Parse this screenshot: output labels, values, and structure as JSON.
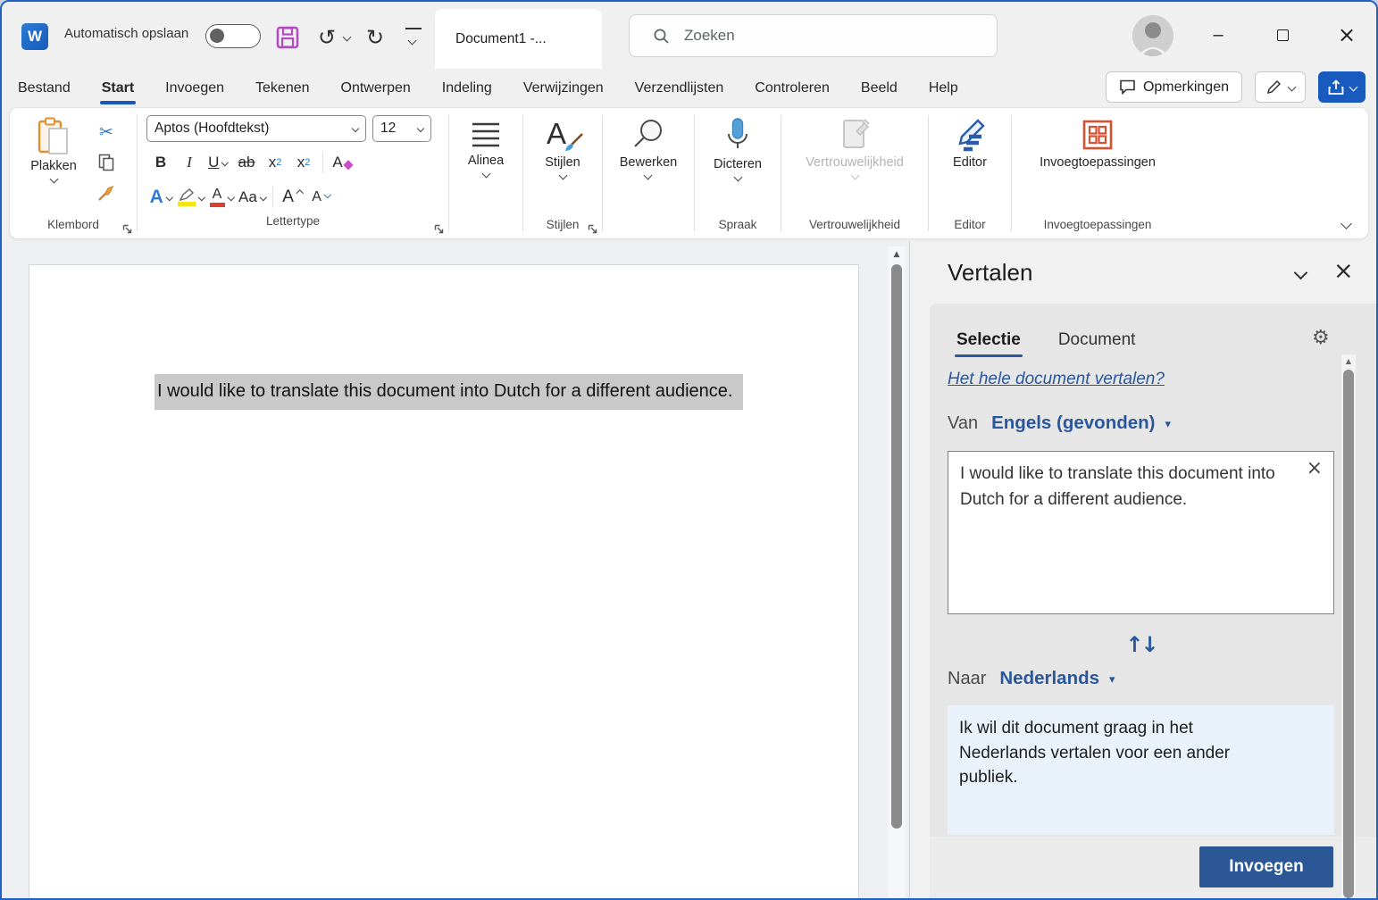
{
  "window": {
    "autosave_label": "Automatisch opslaan",
    "doc_tab": "Document1  -...",
    "search_placeholder": "Zoeken"
  },
  "icons": {
    "undo": "↺",
    "redo": "↻",
    "minimize": "–",
    "close_window": "×",
    "scissors": "✂",
    "gear": "⚙",
    "scroll_up": "▲",
    "dropdown": "▾",
    "swap": "↑↓",
    "clear_x": "×",
    "panel_close": "×"
  },
  "menu": {
    "tabs": [
      {
        "label": "Bestand"
      },
      {
        "label": "Start"
      },
      {
        "label": "Invoegen"
      },
      {
        "label": "Tekenen"
      },
      {
        "label": "Ontwerpen"
      },
      {
        "label": "Indeling"
      },
      {
        "label": "Verwijzingen"
      },
      {
        "label": "Verzendlijsten"
      },
      {
        "label": "Controleren"
      },
      {
        "label": "Beeld"
      },
      {
        "label": "Help"
      }
    ],
    "comments_label": "Opmerkingen"
  },
  "ribbon": {
    "paste_label": "Plakken",
    "clipboard_group": "Klembord",
    "font_name": "Aptos (Hoofdtekst)",
    "font_size": "12",
    "font_group": "Lettertype",
    "bold": "B",
    "italic": "I",
    "underline": "U",
    "strikethrough": "ab",
    "sub_base": "x",
    "sub_small": "2",
    "sup_base": "x",
    "sup_small": "2",
    "clear_format": "A",
    "text_effects": "A",
    "font_color": "A",
    "change_case": "Aa",
    "grow_font": "A",
    "shrink_font": "A",
    "paragraph_label": "Alinea",
    "styles_label": "Stijlen",
    "styles_group": "Stijlen",
    "editing_label": "Bewerken",
    "dictate_label": "Dicteren",
    "speech_group": "Spraak",
    "sensitivity_label": "Vertrouwelijkheid",
    "sensitivity_group": "Vertrouwelijkheid",
    "editor_label": "Editor",
    "editor_group": "Editor",
    "addins_label": "Invoegtoepassingen",
    "addins_group": "Invoegtoepassingen"
  },
  "document": {
    "selected_text": "I would like to translate this document into Dutch for a different audience."
  },
  "panel": {
    "title": "Vertalen",
    "tab_selection": "Selectie",
    "tab_document": "Document",
    "translate_all_link": "Het hele document vertalen?",
    "from_label": "Van",
    "from_language": "Engels (gevonden)",
    "source_text": "I would like to translate this document into Dutch for a different audience.",
    "to_label": "Naar",
    "to_language": "Nederlands",
    "result_text": "Ik wil dit document graag in het Nederlands vertalen voor een ander publiek.",
    "insert_button": "Invoegen"
  },
  "colors": {
    "accent_blue": "#185abd",
    "panel_blue": "#2b579a",
    "insert_button_bg": "#2b5797",
    "selection_gray": "#c9c9c9",
    "result_box_bg": "#e9f2fb"
  }
}
